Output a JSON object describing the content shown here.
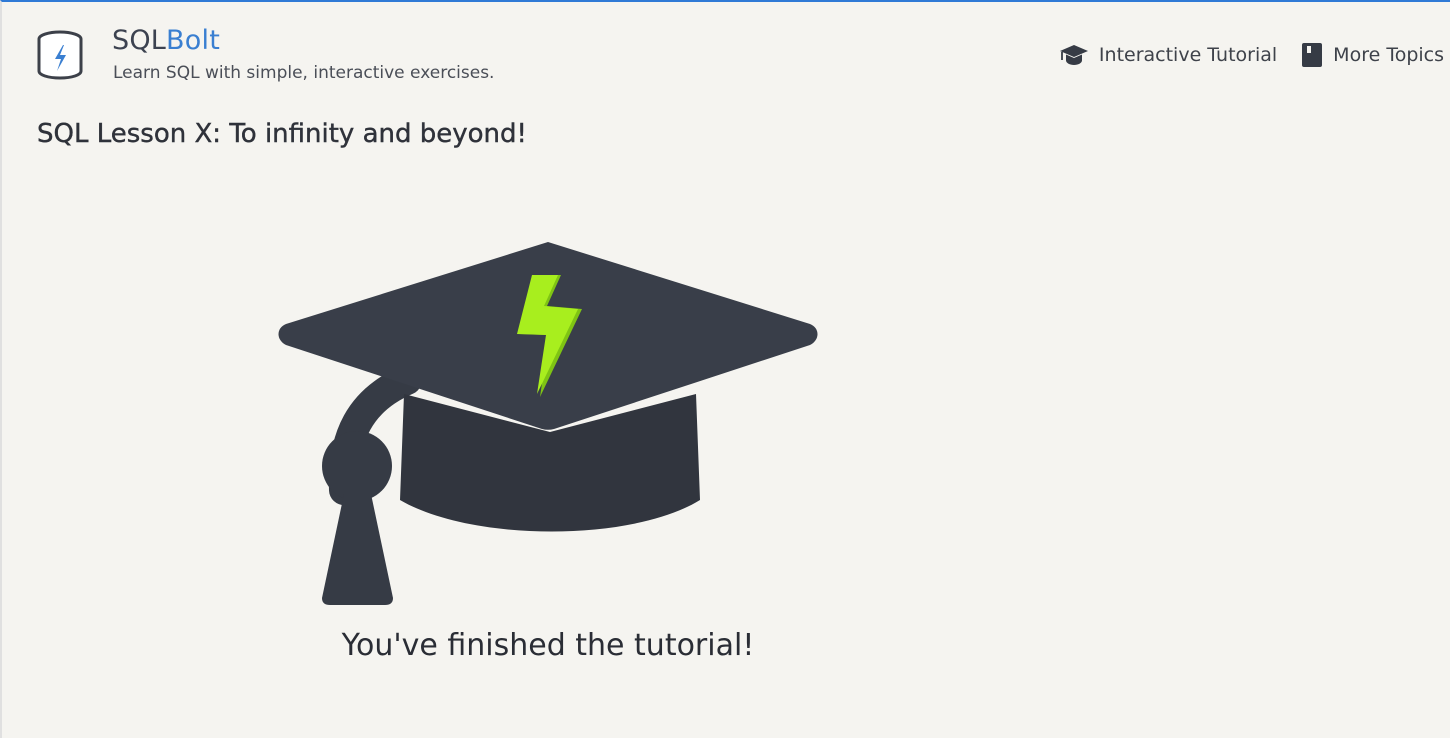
{
  "header": {
    "brand_sql": "SQL",
    "brand_bolt": "Bolt",
    "tagline": "Learn SQL with simple, interactive exercises.",
    "logo_icon": "database-bolt-icon"
  },
  "nav": {
    "items": [
      {
        "label": "Interactive Tutorial",
        "icon": "graduation-cap-icon"
      },
      {
        "label": "More Topics",
        "icon": "book-icon"
      }
    ]
  },
  "lesson": {
    "title": "SQL Lesson X: To infinity and beyond!",
    "completion_message": "You've finished the tutorial!",
    "illustration": "graduation-cap-bolt-icon"
  },
  "colors": {
    "accent_blue": "#3a7fd1",
    "top_border": "#2f7ad6",
    "background": "#f5f4f0",
    "cap_dark": "#363b45",
    "bolt_green": "#9be21b"
  }
}
